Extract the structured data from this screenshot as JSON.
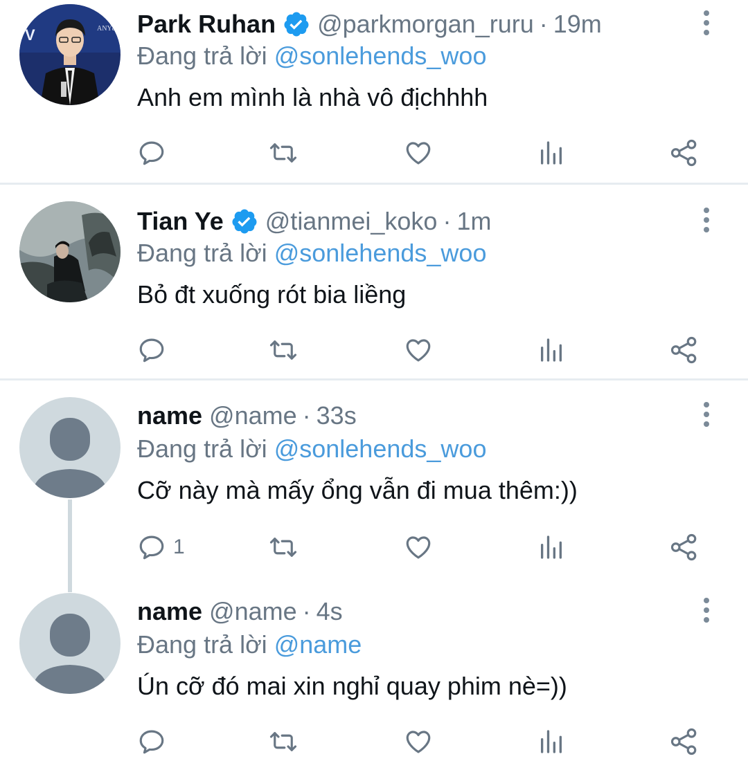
{
  "tweets": [
    {
      "name": "Park Ruhan",
      "verified": true,
      "handle": "@parkmorgan_ruru",
      "dot": "·",
      "time": "19m",
      "reply_prefix": "Đang trả lời",
      "reply_to": "@sonlehends_woo",
      "text": "Anh em mình là nhà vô địchhhh",
      "reply_count": ""
    },
    {
      "name": "Tian Ye",
      "verified": true,
      "handle": "@tianmei_koko",
      "dot": "·",
      "time": "1m",
      "reply_prefix": "Đang trả lời",
      "reply_to": "@sonlehends_woo",
      "text": "Bỏ đt xuống rót bia liềng",
      "reply_count": ""
    },
    {
      "name": "name",
      "verified": false,
      "handle": "@name",
      "dot": "·",
      "time": "33s",
      "reply_prefix": "Đang trả lời",
      "reply_to": "@sonlehends_woo",
      "text": "Cỡ này mà mấy ổng vẫn đi mua thêm:))",
      "reply_count": "1"
    },
    {
      "name": "name",
      "verified": false,
      "handle": "@name",
      "dot": "·",
      "time": "4s",
      "reply_prefix": "Đang trả lời",
      "reply_to": "@name",
      "text": "Ún cỡ đó mai xin nghỉ quay phim nè=))",
      "reply_count": ""
    }
  ],
  "icons": {
    "reply": "reply-icon",
    "retweet": "retweet-icon",
    "like": "like-icon",
    "analytics": "analytics-icon",
    "share": "share-icon",
    "more": "more-icon",
    "verified": "verified-badge-icon"
  },
  "colors": {
    "text": "#0f1419",
    "secondary": "#687684",
    "mention": "#4a9bdc",
    "verified": "#1d9bf0",
    "divider": "#e6ecf0",
    "placeholder_avatar": "#cfd9de",
    "placeholder_figure": "#6e7c8a"
  }
}
